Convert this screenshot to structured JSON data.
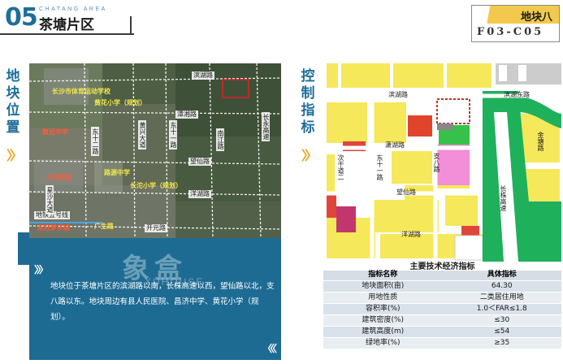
{
  "header": {
    "number": "05",
    "english": "CHATANG AREA",
    "title": "茶塘片区"
  },
  "plot": {
    "title": "地块八",
    "code": "F03-C05"
  },
  "sections": {
    "location_title": "地块位置",
    "control_title": "控制指标"
  },
  "location_map": {
    "labels": {
      "changsha_sports": "长沙市体育运动学校",
      "huanghua_school": "黄花小学（规划）",
      "binhu_road": "滨湖路",
      "taoxiang_road": "潭湘路",
      "nanjiang_road": "南江路",
      "huangxingjia": "黄兴大道",
      "dongshiyi": "东十一路",
      "dongshierlu": "东十二路",
      "wangxian_road": "望仙路",
      "changtai_school": "长沱小学（规划）",
      "yanghu_road": "洋湖路",
      "kaiyuan_road": "开元路",
      "changyong": "长永高速",
      "zhixin": "致远中学",
      "lurong_school": "路源中学",
      "hospital": "人民医院",
      "guangsheng": "广生路",
      "metro5": "地铁五号线",
      "yongwang": "永旺梦乐城",
      "chenbei": "星沙大道"
    }
  },
  "description": "地块位于茶塘片区的滨湖路以南，长株高速以西，望仙路以北，支八路以东。地块周边有县人民医院、昌济中学、黄花小学（规划）。",
  "control_map": {
    "labels": {
      "binhu": "滨湖路",
      "binhu_east": "滨湖东路",
      "xiaohu": "潇湖路",
      "dongshiyi": "东十一路",
      "zhiba": "支八路",
      "ciganyi": "次干道二",
      "wangxian": "望仙路",
      "yanghu": "洋湖路",
      "jintang": "金塘路",
      "changzhu": "长株高速"
    }
  },
  "table": {
    "title": "主要技术经济指标",
    "headers": [
      "指标名称",
      "具体指标"
    ],
    "rows": [
      [
        "地块面积(亩)",
        "64.30"
      ],
      [
        "用地性质",
        "二类居住用地"
      ],
      [
        "容积率(%)",
        "1.0＜FAR≤1.8"
      ],
      [
        "建筑密度(%)",
        "≤30"
      ],
      [
        "建筑高度(m)",
        "≤54"
      ],
      [
        "绿地率(%)",
        "≥35"
      ]
    ]
  },
  "watermark": {
    "cn": "象盒",
    "en": "XUHOUSE"
  },
  "colors": {
    "accent_blue": "#1d6b93",
    "accent_yellow": "#f2c94c",
    "chevron": "#e8a623"
  }
}
